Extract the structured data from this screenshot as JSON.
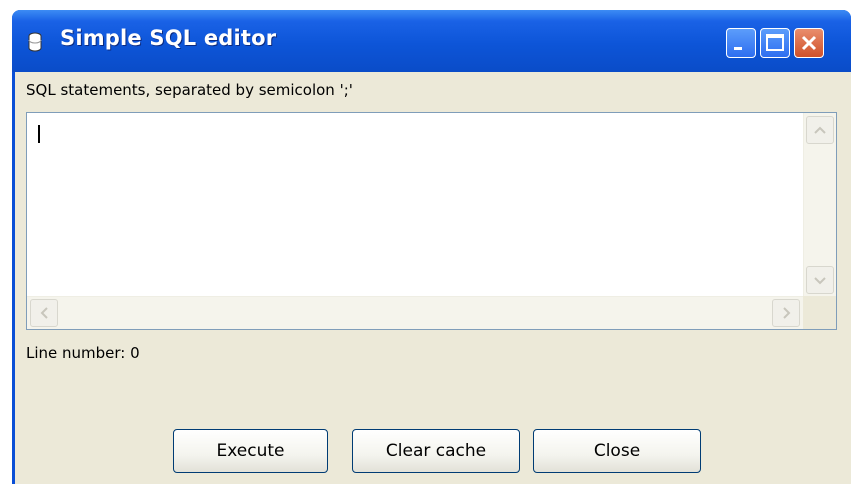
{
  "window": {
    "title": "Simple SQL editor"
  },
  "editor": {
    "label": "SQL statements, separated by semicolon ';'",
    "value": ""
  },
  "status": {
    "line_number": "Line number: 0"
  },
  "buttons": {
    "execute": "Execute",
    "clear_cache": "Clear cache",
    "close": "Close"
  },
  "icons": [
    "database-icon",
    "minimize-icon",
    "maximize-icon",
    "close-icon",
    "scroll-up-arrow-icon",
    "scroll-down-arrow-icon",
    "scroll-left-arrow-icon",
    "scroll-right-arrow-icon"
  ]
}
